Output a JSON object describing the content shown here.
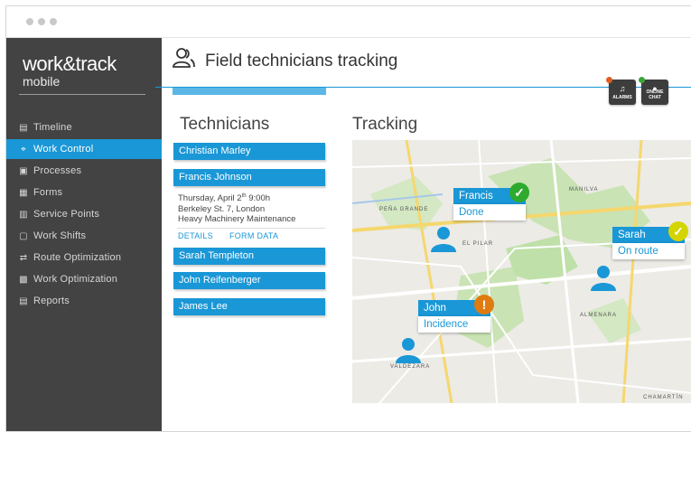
{
  "app": {
    "logo_line1": "work&track",
    "logo_line2": "mobile"
  },
  "header": {
    "title": "Field technicians tracking",
    "alarms_label": "ALARMS",
    "chat_label": "ONLINE CHAT"
  },
  "sidebar": {
    "items": [
      {
        "label": "Timeline",
        "icon": "timeline-icon"
      },
      {
        "label": "Work Control",
        "icon": "crosshair-icon"
      },
      {
        "label": "Processes",
        "icon": "processes-icon"
      },
      {
        "label": "Forms",
        "icon": "forms-icon"
      },
      {
        "label": "Service Points",
        "icon": "map-icon"
      },
      {
        "label": "Work Shifts",
        "icon": "calendar-icon"
      },
      {
        "label": "Route Optimization",
        "icon": "shuffle-icon"
      },
      {
        "label": "Work Optimization",
        "icon": "grid-icon"
      },
      {
        "label": "Reports",
        "icon": "report-icon"
      }
    ]
  },
  "technicians": {
    "title": "Technicians",
    "list": [
      "Christian Marley",
      "Francis Johnson",
      "Sarah Templeton",
      "John Reifenberger",
      "James Lee"
    ],
    "detail": {
      "date": "Thursday, April 2",
      "date_sup": "th",
      "time": " 9:00h",
      "address": "Berkeley St. 7, London",
      "job": "Heavy Machinery Maintenance",
      "link_details": "DETAILS",
      "link_form": "FORM DATA"
    }
  },
  "tracking": {
    "title": "Tracking",
    "callouts": [
      {
        "name": "Francis",
        "status": "Done",
        "marker": "check",
        "color": "#2eaa2e"
      },
      {
        "name": "Sarah",
        "status": "On route",
        "marker": "check",
        "color": "#d4d400"
      },
      {
        "name": "John",
        "status": "Incidence",
        "marker": "exclamation",
        "color": "#e07b12"
      }
    ],
    "map_labels": [
      "MANILVA",
      "PEÑA GRANDE",
      "EL PILAR",
      "ALMENARA",
      "VALDEZARA",
      "CHAMARTÍN"
    ]
  },
  "colors": {
    "accent": "#1a97d6",
    "sidebar": "#434343",
    "alarm_badge": "#e25b1f",
    "chat_badge": "#3aa63a"
  }
}
